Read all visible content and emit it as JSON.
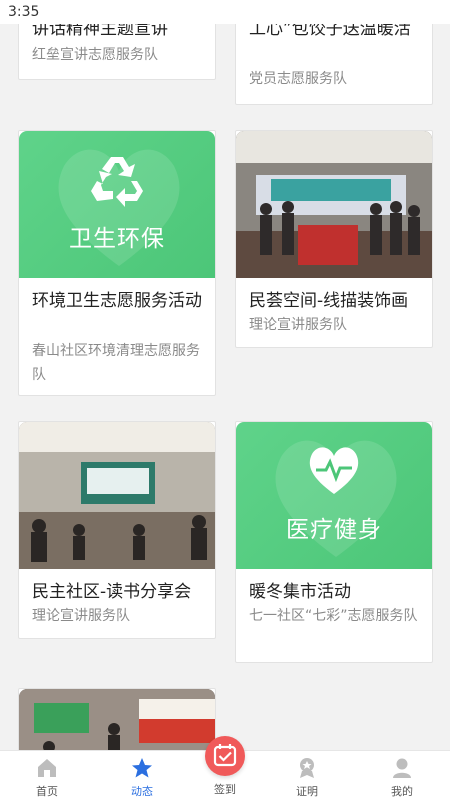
{
  "status": {
    "time": "3:35"
  },
  "cards": [
    {
      "title": "讲话精神主题宣讲",
      "org": "红垒宣讲志愿服务队"
    },
    {
      "title": "工心”包饺子送温暖活",
      "org": "党员志愿服务队"
    },
    {
      "title": "环境卫生志愿服务活动",
      "org": "春山社区环境清理志愿服务队",
      "tile_text": "卫生环保"
    },
    {
      "title": "民荟空间-线描装饰画",
      "org": "理论宣讲服务队"
    },
    {
      "title": "民主社区-读书分享会",
      "org": "理论宣讲服务队"
    },
    {
      "title": "暖冬集市活动",
      "org": "七一社区“七彩”志愿服务队",
      "tile_text": "医疗健身"
    }
  ],
  "tabs": [
    {
      "label": "首页",
      "icon": "home-icon"
    },
    {
      "label": "动态",
      "icon": "star-icon"
    },
    {
      "label": "签到",
      "icon": "calendar-check-icon"
    },
    {
      "label": "证明",
      "icon": "award-icon"
    },
    {
      "label": "我的",
      "icon": "user-icon"
    }
  ],
  "colors": {
    "accent": "#2b6fe0",
    "tile_green": "#55cc80",
    "signin": "#f05a5a"
  }
}
